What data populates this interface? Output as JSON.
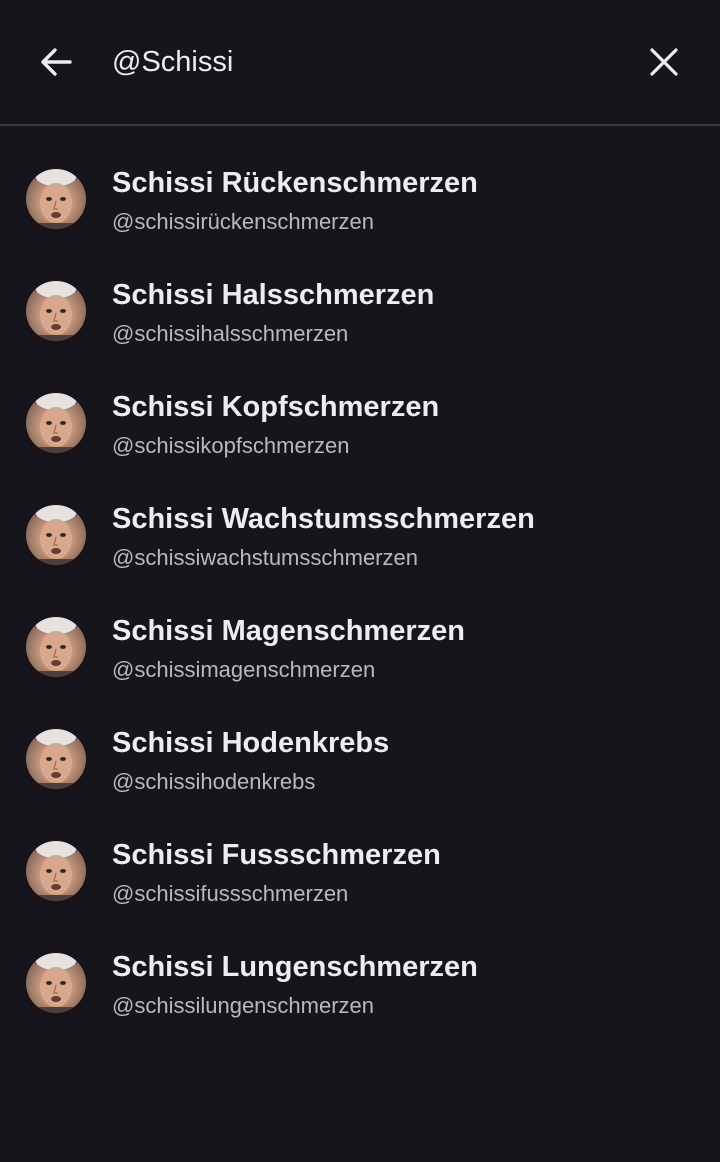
{
  "search": {
    "value": "@Schissi",
    "back_icon": "arrow-left-icon",
    "clear_icon": "close-icon"
  },
  "results": [
    {
      "name": "Schissi Rückenschmerzen",
      "handle": "@schissirückenschmerzen"
    },
    {
      "name": "Schissi Halsschmerzen",
      "handle": "@schissihalsschmerzen"
    },
    {
      "name": "Schissi Kopfschmerzen",
      "handle": "@schissikopfschmerzen"
    },
    {
      "name": "Schissi Wachstumsschmerzen",
      "handle": "@schissiwachstumsschmerzen"
    },
    {
      "name": "Schissi Magenschmerzen",
      "handle": "@schissimagenschmerzen"
    },
    {
      "name": "Schissi Hodenkrebs",
      "handle": "@schissihodenkrebs"
    },
    {
      "name": "Schissi Fussschmerzen",
      "handle": "@schissifussschmerzen"
    },
    {
      "name": "Schissi Lungenschmerzen",
      "handle": "@schissilungenschmerzen"
    }
  ],
  "colors": {
    "background": "#16151b",
    "text_primary": "#ececf1",
    "text_secondary": "#b9b8c0",
    "divider": "#3a3940"
  }
}
